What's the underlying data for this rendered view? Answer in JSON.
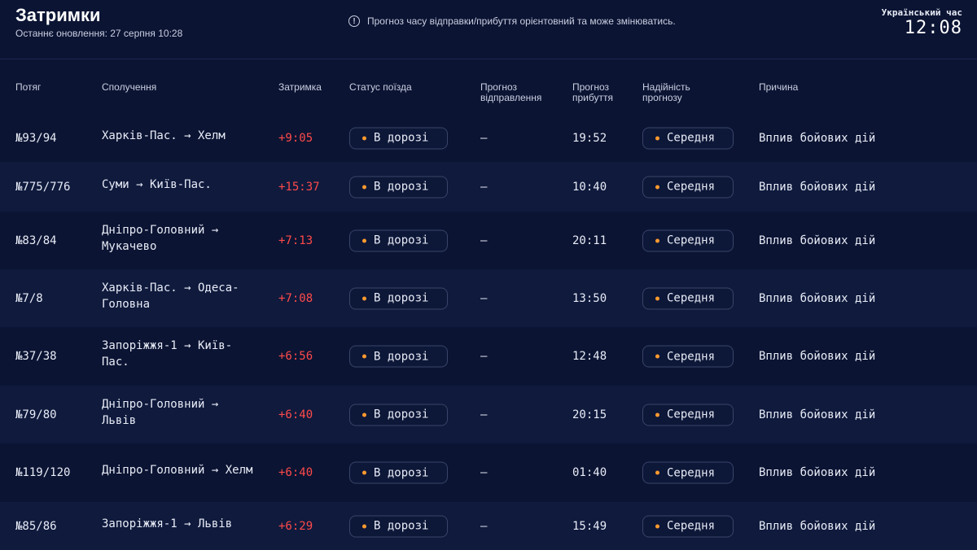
{
  "header": {
    "title": "Затримки",
    "last_update": "Останнє оновлення: 27 серпня 10:28",
    "notice": "Прогноз часу відправки/прибуття орієнтовний та може змінюватись.",
    "clock_label": "Український час",
    "clock_time": "12:08"
  },
  "columns": {
    "train": "Потяг",
    "route": "Сполучення",
    "delay": "Затримка",
    "status": "Статус поїзда",
    "departure_forecast": "Прогноз відправлення",
    "arrival_forecast": "Прогноз прибуття",
    "reliability": "Надійність прогнозу",
    "reason": "Причина"
  },
  "rows": [
    {
      "train": "№93/94",
      "route": "Харків-Пас. → Хелм",
      "delay": "+9:05",
      "status": "В дорозі",
      "departure": "—",
      "arrival": "19:52",
      "reliability": "Середня",
      "reason": "Вплив бойових дій"
    },
    {
      "train": "№775/776",
      "route": "Суми → Київ-Пас.",
      "delay": "+15:37",
      "status": "В дорозі",
      "departure": "—",
      "arrival": "10:40",
      "reliability": "Середня",
      "reason": "Вплив бойових дій"
    },
    {
      "train": "№83/84",
      "route": "Дніпро-Головний → Мукачево",
      "delay": "+7:13",
      "status": "В дорозі",
      "departure": "—",
      "arrival": "20:11",
      "reliability": "Середня",
      "reason": "Вплив бойових дій"
    },
    {
      "train": "№7/8",
      "route": "Харків-Пас. → Одеса-Головна",
      "delay": "+7:08",
      "status": "В дорозі",
      "departure": "—",
      "arrival": "13:50",
      "reliability": "Середня",
      "reason": "Вплив бойових дій"
    },
    {
      "train": "№37/38",
      "route": "Запоріжжя-1 → Київ-Пас.",
      "delay": "+6:56",
      "status": "В дорозі",
      "departure": "—",
      "arrival": "12:48",
      "reliability": "Середня",
      "reason": "Вплив бойових дій"
    },
    {
      "train": "№79/80",
      "route": "Дніпро-Головний → Львів",
      "delay": "+6:40",
      "status": "В дорозі",
      "departure": "—",
      "arrival": "20:15",
      "reliability": "Середня",
      "reason": "Вплив бойових дій"
    },
    {
      "train": "№119/120",
      "route": "Дніпро-Головний → Хелм",
      "delay": "+6:40",
      "status": "В дорозі",
      "departure": "—",
      "arrival": "01:40",
      "reliability": "Середня",
      "reason": "Вплив бойових дій"
    },
    {
      "train": "№85/86",
      "route": "Запоріжжя-1 → Львів",
      "delay": "+6:29",
      "status": "В дорозі",
      "departure": "—",
      "arrival": "15:49",
      "reliability": "Середня",
      "reason": "Вплив бойових дій"
    }
  ],
  "colors": {
    "background": "#0b1433",
    "row_alt": "#0f1a3d",
    "delay": "#ff4a4a",
    "status_dot": "#ff9a2e"
  },
  "icons": {
    "notice": "info-circle-icon",
    "status": "dot-icon"
  }
}
